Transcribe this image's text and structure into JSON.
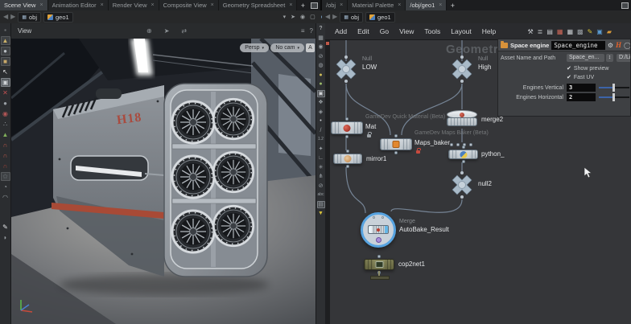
{
  "left_pane": {
    "tabs": [
      {
        "label": "Scene View",
        "active": true
      },
      {
        "label": "Animation Editor"
      },
      {
        "label": "Render View"
      },
      {
        "label": "Composite View"
      },
      {
        "label": "Geometry Spreadsheet"
      }
    ],
    "path_chips": {
      "root": "obj",
      "node": "geo1"
    },
    "header": {
      "view_label": "View",
      "help_glyph": "?"
    },
    "header_icons": [
      {
        "name": "select-mode-icon",
        "glyph": "⊕"
      },
      {
        "name": "handles-icon",
        "glyph": "➤"
      },
      {
        "name": "move-mode-icon",
        "glyph": "⇄"
      }
    ],
    "pills": {
      "projection": "Persp",
      "camera": "No cam",
      "caret": "▾",
      "snapshot_label": "A"
    },
    "toolbar_left": [
      {
        "name": "pane-handle-icon",
        "glyph": "▪",
        "color": "#6f7376"
      },
      {
        "name": "tool-cone-icon",
        "glyph": "▲",
        "color": "#cdb36a",
        "boxed": true
      },
      {
        "name": "tool-sphere-icon",
        "glyph": "●",
        "color": "#b9bec3",
        "boxed": true
      },
      {
        "name": "tool-box-icon",
        "glyph": "■",
        "color": "#c9a96a",
        "boxed": true
      },
      {
        "name": "select-arrow-icon",
        "glyph": "↖",
        "color": "#e9eaeb"
      },
      {
        "name": "lock-handle-icon",
        "glyph": "▣",
        "color": "#d0d4d7",
        "boxed": true,
        "active": true
      },
      {
        "name": "pose-tool-icon",
        "glyph": "✕",
        "color": "#c05050"
      },
      {
        "name": "sphere-tool-icon",
        "glyph": "●",
        "color": "#9aa0a5"
      },
      {
        "name": "paint-sphere-icon",
        "glyph": "◉",
        "color": "#b05555"
      },
      {
        "name": "scatter-tool-icon",
        "glyph": "∴",
        "color": "#9aa0a5"
      },
      {
        "name": "tree-tool-icon",
        "glyph": "▲",
        "color": "#7fae5a"
      },
      {
        "name": "magnet-weak-icon",
        "glyph": "∩",
        "color": "#c25a4a"
      },
      {
        "name": "magnet-mid-icon",
        "glyph": "∩",
        "color": "#c25a4a"
      },
      {
        "name": "magnet-strong-icon",
        "glyph": "∩",
        "color": "#a84438"
      },
      {
        "name": "flower-tool-icon",
        "glyph": "✿",
        "color": "#53575b",
        "boxed": true
      },
      {
        "name": "orbit-tool-icon",
        "glyph": "◔",
        "color": "#9aa0a5"
      },
      {
        "name": "dome-tool-icon",
        "glyph": "◠",
        "color": "#9aa0a5"
      },
      {
        "name": "brush-icon",
        "glyph": "✎",
        "color": "#e0e2e4",
        "gap": true
      },
      {
        "name": "shell-icon",
        "glyph": "◗",
        "color": "#9aa0a5"
      }
    ],
    "toolbar_right": [
      {
        "name": "help-icon",
        "glyph": "?",
        "color": "#d0d3d6"
      },
      {
        "name": "image-plane-icon",
        "glyph": "▦",
        "color": "#9aa0a5"
      },
      {
        "name": "lock-view-icon",
        "glyph": "◉",
        "color": "#9aa0a5"
      },
      {
        "name": "disable-lighting-icon",
        "glyph": "⊘",
        "color": "#9aa0a5"
      },
      {
        "name": "globe-icon",
        "glyph": "◍",
        "color": "#9aa0a5"
      },
      {
        "name": "headlight-icon",
        "glyph": "●",
        "color": "#cdbc5a"
      },
      {
        "name": "normal-lights-icon",
        "glyph": "●",
        "color": "#9ab86a"
      },
      {
        "name": "high-quality-icon",
        "glyph": "▣",
        "color": "#d2d5d8",
        "boxed": true
      },
      {
        "name": "shade-mode-icon",
        "glyph": "❖",
        "color": "#9aa0a5"
      },
      {
        "name": "wireframe-icon",
        "glyph": "◈",
        "color": "#9aa0a5"
      },
      {
        "name": "point-marker-icon",
        "glyph": "•",
        "color": "#c9cdd1"
      },
      {
        "name": "normal-marker-icon",
        "glyph": "/",
        "color": "#9aa0a5"
      },
      {
        "name": "uv-overlay-icon",
        "glyph": "1.2",
        "color": "#9aa0a5",
        "small": true
      },
      {
        "name": "hand-tool-icon",
        "glyph": "✦",
        "color": "#9aa0a5"
      },
      {
        "name": "grid-corner-icon",
        "glyph": "∟",
        "color": "#9aa0a5"
      },
      {
        "name": "snap-frame-icon",
        "glyph": "✳",
        "color": "#9aa0a5"
      },
      {
        "name": "group-select-icon",
        "glyph": "⋔",
        "color": "#9aa0a5"
      },
      {
        "name": "visibility-icon",
        "glyph": "⊘",
        "color": "#9aa0a5"
      },
      {
        "name": "text-overlay-icon",
        "glyph": "abc",
        "color": "#9aa0a5",
        "small": true
      },
      {
        "name": "snapshot-icon",
        "glyph": "▤",
        "color": "#9aa0a5",
        "boxed": true
      },
      {
        "name": "pin-icon",
        "glyph": "▼",
        "color": "#d8c23a"
      }
    ],
    "model_decal": "H18"
  },
  "right_pane": {
    "tabs": [
      {
        "label": "/obj"
      },
      {
        "label": "Material Palette"
      },
      {
        "label": "/obj/geo1",
        "active": true
      }
    ],
    "path_chips": {
      "root": "obj",
      "node": "geo1"
    },
    "menu": [
      {
        "name": "menu-add",
        "label": "Add"
      },
      {
        "name": "menu-edit",
        "label": "Edit"
      },
      {
        "name": "menu-go",
        "label": "Go"
      },
      {
        "name": "menu-view",
        "label": "View"
      },
      {
        "name": "menu-tools",
        "label": "Tools"
      },
      {
        "name": "menu-layout",
        "label": "Layout"
      },
      {
        "name": "menu-help",
        "label": "Help"
      }
    ],
    "menu_icons": [
      {
        "name": "net-tools-icon",
        "glyph": "⚒",
        "color": "#c8ccd0"
      },
      {
        "name": "net-tree-icon",
        "glyph": "≣",
        "color": "#c8ccd0"
      },
      {
        "name": "net-list-icon",
        "glyph": "▤",
        "color": "#c8ccd0"
      },
      {
        "name": "net-colorgrid-icon",
        "glyph": "▦",
        "color": "#d0695a"
      },
      {
        "name": "net-grid-icon",
        "glyph": "▦",
        "color": "#c8ccd0"
      },
      {
        "name": "net-minimap-icon",
        "glyph": "▩",
        "color": "#9aa0a5"
      },
      {
        "name": "net-notes-icon",
        "glyph": "✎",
        "color": "#d8c23a"
      },
      {
        "name": "net-bgimage-icon",
        "glyph": "▣",
        "color": "#5a9ad0"
      },
      {
        "name": "net-folder-icon",
        "glyph": "▰",
        "color": "#d89a3a"
      }
    ],
    "watermark": "Geometry",
    "nodes": {
      "low": {
        "type_label": "Null",
        "name": "LOW"
      },
      "high": {
        "type_label": "Null",
        "name": "High"
      },
      "mat": {
        "title": "GameDev Quick Material (Beta)",
        "name": "Mat"
      },
      "merge2": {
        "name": "merge2"
      },
      "maps_baker": {
        "title": "GameDev Maps Baker (Beta)",
        "name": "Maps_baker"
      },
      "python": {
        "name": "python_"
      },
      "mirror1": {
        "name": "mirror1"
      },
      "null2": {
        "name": "null2"
      },
      "autobake": {
        "type_label": "Merge",
        "name": "AutoBake_Result"
      },
      "cop2net1": {
        "name": "cop2net1"
      }
    },
    "params": {
      "title": "Space engine",
      "name_field": "Space_engine",
      "asset_label": "Asset Name and Path",
      "asset_value": "Space_en...",
      "asset_stepper": "↕",
      "asset_path": "D:/Li",
      "check_glyph": "✔",
      "checkboxes": [
        "Show preview",
        "Fast UV"
      ],
      "fields": [
        {
          "label": "Engines Vertical",
          "value": "3"
        },
        {
          "label": "Engines Horizontal",
          "value": "2"
        }
      ],
      "header_icons": {
        "gear": "⚙",
        "logo": "H",
        "circle": "◯"
      }
    }
  },
  "icons": {
    "plus": "+",
    "close": "×",
    "back": "◀",
    "forward": "▶",
    "caret_down": "▾",
    "list": "≡",
    "pin": "➤",
    "radial": "◉",
    "cube": "▢",
    "user": "◗"
  },
  "colors": {
    "selection_blue": "#57a3e0",
    "slider_blue": "#3c64a8",
    "wire": "#7d8da0",
    "node_body": "#c2cad1",
    "null_node": "#a9bac8",
    "olive_node": "#6d6d47",
    "stripe_red": "#a84a36",
    "decal_red": "#b23b2b",
    "watermark": "#5a5d61"
  }
}
